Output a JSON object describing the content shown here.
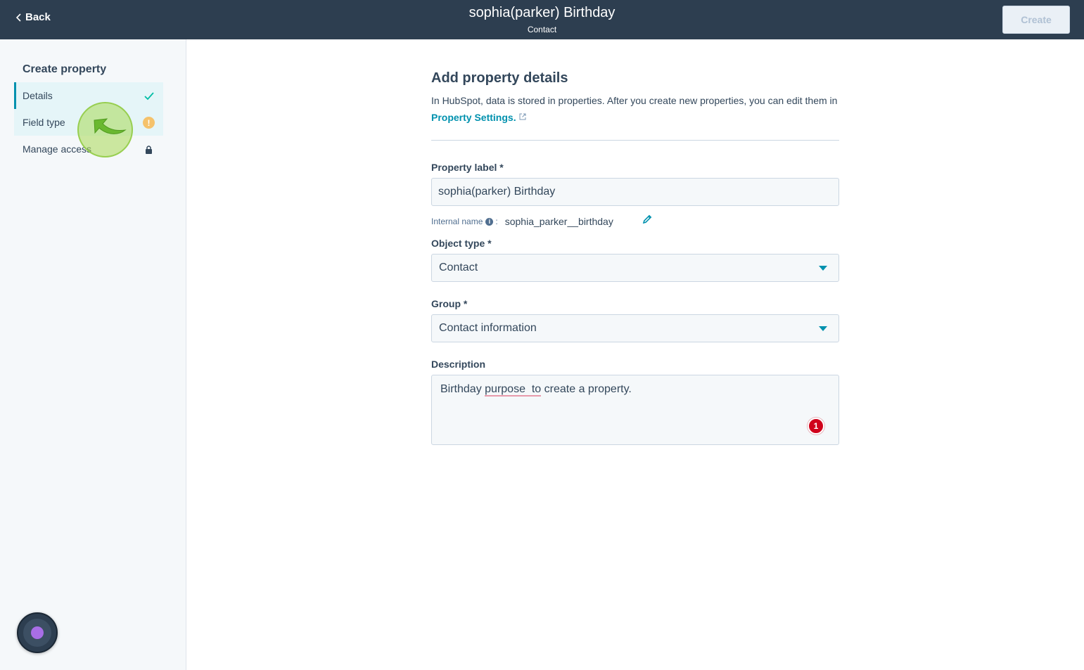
{
  "header": {
    "back_label": "Back",
    "title": "sophia(parker) Birthday",
    "subtitle": "Contact",
    "create_label": "Create"
  },
  "sidebar": {
    "title": "Create property",
    "items": [
      {
        "label": "Details",
        "status": "check-icon"
      },
      {
        "label": "Field type",
        "status": "warning-icon"
      },
      {
        "label": "Manage access",
        "status": "lock-icon"
      }
    ]
  },
  "main": {
    "heading": "Add property details",
    "intro_text": "In HubSpot, data is stored in properties. After you create new properties, you can edit them in",
    "intro_link": "Property Settings.",
    "property_label": {
      "label": "Property label *",
      "value": "sophia(parker) Birthday"
    },
    "internal_name": {
      "label": "Internal name",
      "info_glyph": "i",
      "separator": ":",
      "value": "sophia_parker__birthday"
    },
    "object_type": {
      "label": "Object type *",
      "value": "Contact"
    },
    "group": {
      "label": "Group *",
      "value": "Contact information"
    },
    "description": {
      "label": "Description",
      "value_before": "Birthday ",
      "value_misspelled": "purpose  to",
      "value_after": " create a property.",
      "spellcheck_count": "1"
    }
  },
  "colors": {
    "header_bg": "#2d3e50",
    "accent": "#0091ae",
    "check": "#00bda5",
    "warning": "#f5c26b",
    "badge": "#d0021b",
    "assistant": "#a86ee6"
  }
}
